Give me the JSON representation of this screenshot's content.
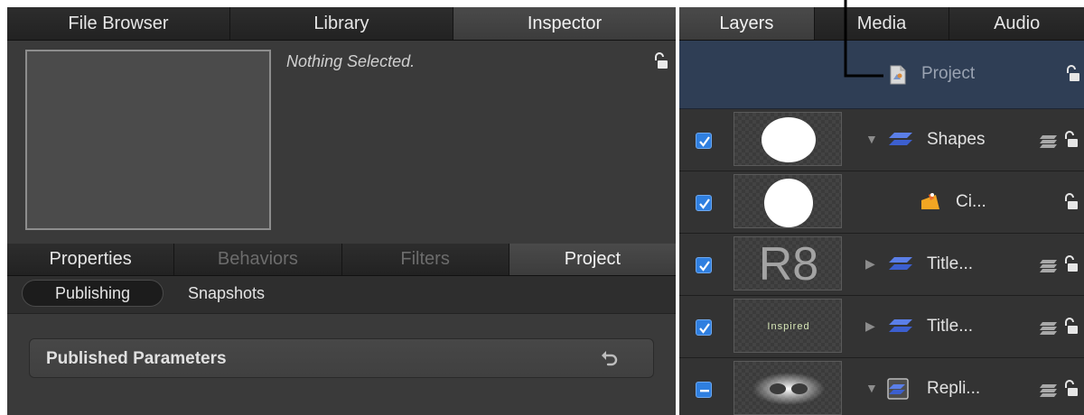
{
  "left_panel": {
    "top_tabs": [
      {
        "label": "File Browser",
        "active": false
      },
      {
        "label": "Library",
        "active": false
      },
      {
        "label": "Inspector",
        "active": true
      }
    ],
    "status_text": "Nothing Selected.",
    "sub_tabs": [
      {
        "label": "Properties",
        "state": "normal"
      },
      {
        "label": "Behaviors",
        "state": "disabled"
      },
      {
        "label": "Filters",
        "state": "disabled"
      },
      {
        "label": "Project",
        "state": "active"
      }
    ],
    "segments": {
      "publishing": "Publishing",
      "snapshots": "Snapshots"
    },
    "params_bar_label": "Published Parameters"
  },
  "right_panel": {
    "tabs": [
      {
        "label": "Layers",
        "active": true
      },
      {
        "label": "Media",
        "active": false
      },
      {
        "label": "Audio",
        "active": false
      }
    ],
    "project_row": {
      "label": "Project"
    },
    "layers": [
      {
        "name": "Shapes",
        "checked": true,
        "expanded": true,
        "thumb": "ellipse",
        "icon": "group-icon"
      },
      {
        "name": "Ci...",
        "checked": true,
        "expanded": null,
        "thumb": "circle",
        "icon": "shape-icon"
      },
      {
        "name": "Title...",
        "checked": true,
        "expanded": false,
        "thumb": "R8",
        "icon": "group-icon"
      },
      {
        "name": "Title...",
        "checked": true,
        "expanded": false,
        "thumb": "Inspired",
        "icon": "group-icon"
      },
      {
        "name": "Repli...",
        "checked": "mixed",
        "expanded": true,
        "thumb": "replicator",
        "icon": "replicator-icon"
      }
    ],
    "thumb_text": {
      "r8": "R8",
      "inspired": "Inspired"
    }
  },
  "colors": {
    "selection_row": "#2f3e55",
    "checkbox_blue": "#2f7fe0",
    "panel_bg": "#3a3a3a"
  }
}
